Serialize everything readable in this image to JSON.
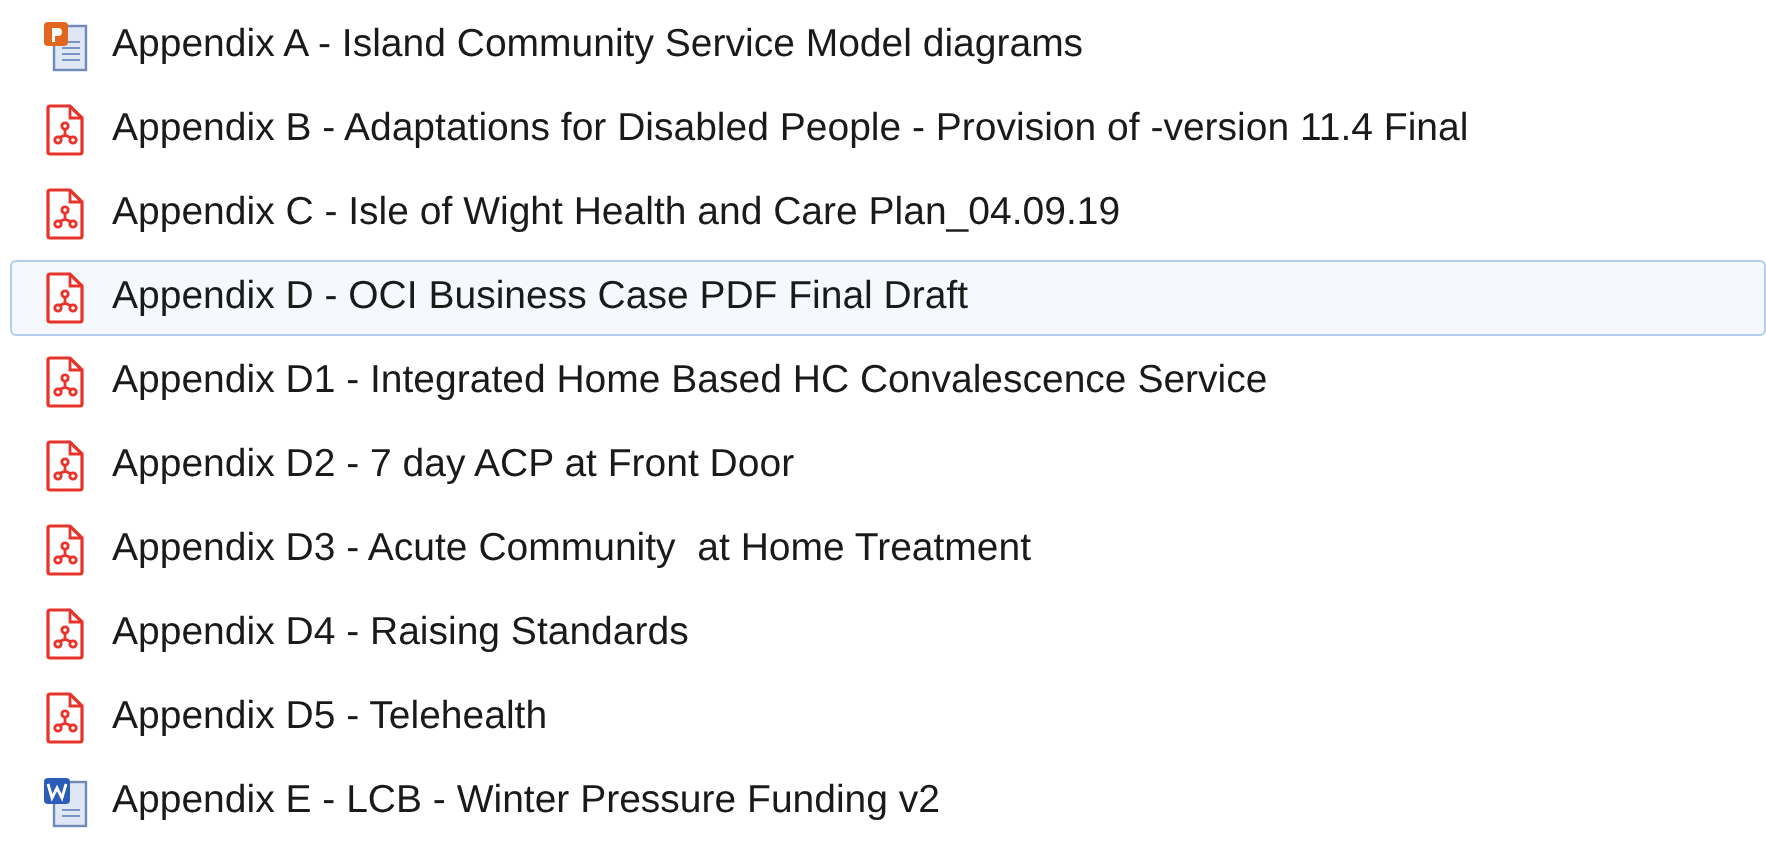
{
  "files": [
    {
      "kind": "ppt",
      "name": "Appendix A - Island Community Service Model diagrams",
      "selected": false
    },
    {
      "kind": "pdf",
      "name": "Appendix B - Adaptations for Disabled People - Provision of -version 11.4 Final",
      "selected": false
    },
    {
      "kind": "pdf",
      "name": "Appendix C - Isle of Wight Health and Care Plan_04.09.19",
      "selected": false
    },
    {
      "kind": "pdf",
      "name": "Appendix D - OCI Business Case PDF Final Draft",
      "selected": true
    },
    {
      "kind": "pdf",
      "name": "Appendix D1 - Integrated Home Based HC Convalescence Service",
      "selected": false
    },
    {
      "kind": "pdf",
      "name": "Appendix D2 - 7 day ACP at Front Door",
      "selected": false
    },
    {
      "kind": "pdf",
      "name": "Appendix D3 - Acute Community  at Home Treatment",
      "selected": false
    },
    {
      "kind": "pdf",
      "name": "Appendix D4 - Raising Standards",
      "selected": false
    },
    {
      "kind": "pdf",
      "name": "Appendix D5 - Telehealth",
      "selected": false
    },
    {
      "kind": "word",
      "name": "Appendix E - LCB - Winter Pressure Funding v2",
      "selected": false
    }
  ]
}
